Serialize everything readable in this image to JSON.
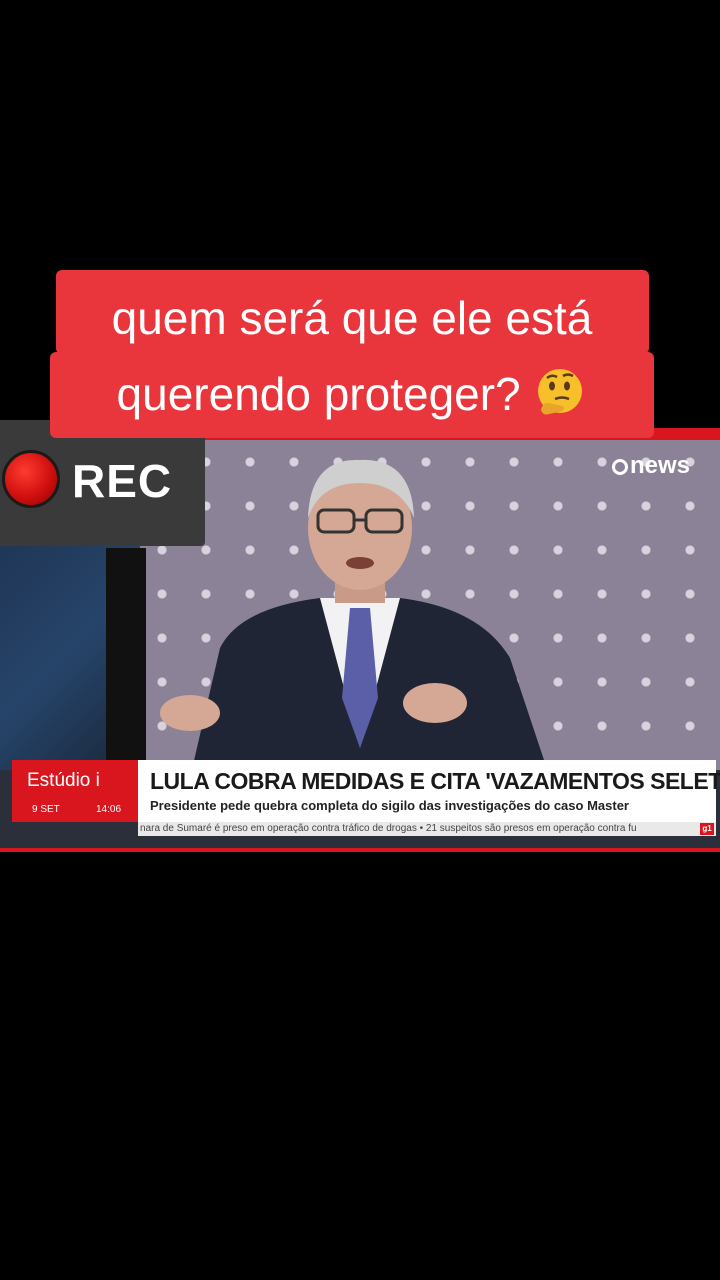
{
  "caption": {
    "line1": "quem será que ele está",
    "line2": "querendo proteger?",
    "emoji_icon": "thinking-face-icon",
    "background_color": "#e8363c"
  },
  "rec_indicator": {
    "label": "REC",
    "dot_color": "#d01010"
  },
  "broadcast": {
    "channel_logo": "news",
    "program": "Estúdio i",
    "date": "9 SET",
    "time": "14:06",
    "headline": "LULA COBRA MEDIDAS E CITA 'VAZAMENTOS SELETIVOS'",
    "subheadline": "Presidente pede quebra completa do sigilo das investigações do caso Master",
    "ticker": "nara de Sumaré é preso em operação contra tráfico de drogas  •  21 suspeitos são presos em operação contra fu",
    "ticker_badge": "g1",
    "accent_color": "#d9161e"
  }
}
